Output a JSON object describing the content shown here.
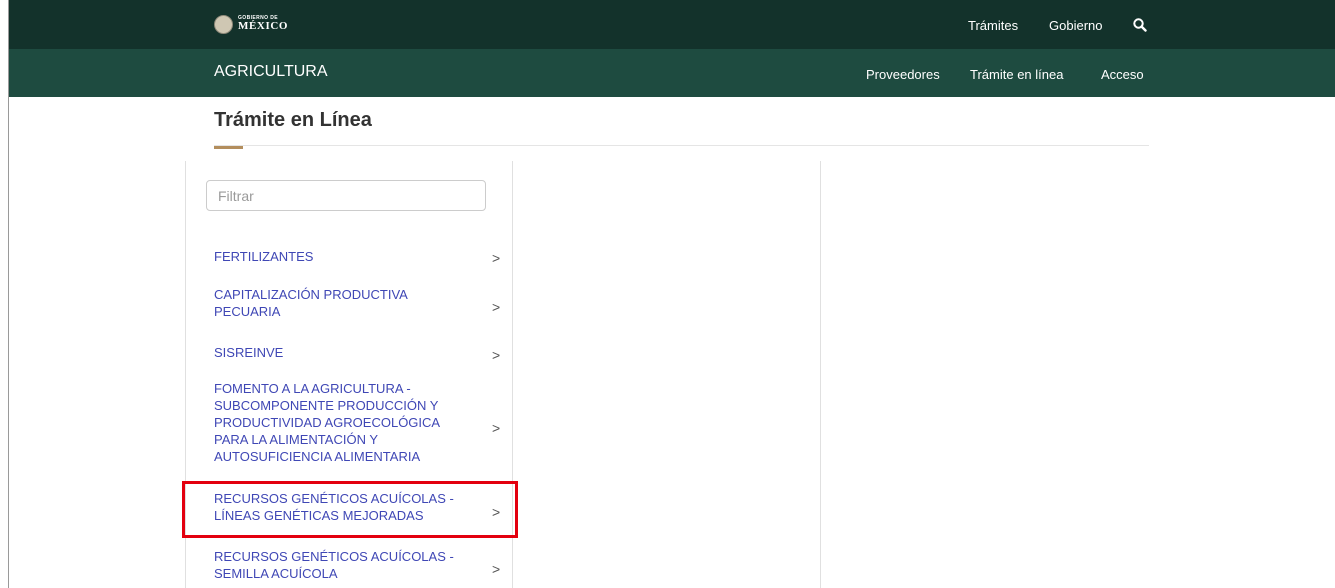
{
  "header": {
    "logo": {
      "line1": "GOBIERNO DE",
      "line2": "MÉXICO"
    },
    "nav": [
      {
        "label": "Trámites"
      },
      {
        "label": "Gobierno"
      }
    ],
    "search_icon": "search-icon",
    "colors": {
      "top_bar": "#13322b",
      "sub_bar": "#1e4b40",
      "accent": "#b38e5d"
    }
  },
  "subheader": {
    "department": "AGRICULTURA",
    "nav": [
      {
        "label": "Proveedores"
      },
      {
        "label": "Trámite en línea"
      },
      {
        "label": "Acceso"
      }
    ]
  },
  "page": {
    "title": "Trámite en Línea"
  },
  "filter": {
    "placeholder": "Filtrar",
    "value": ""
  },
  "menu": {
    "items": [
      {
        "label": "FERTILIZANTES",
        "chevron": ">"
      },
      {
        "label": "CAPITALIZACIÓN PRODUCTIVA PECUARIA",
        "chevron": ">"
      },
      {
        "label": "SISREINVE",
        "chevron": ">"
      },
      {
        "label": "FOMENTO A LA AGRICULTURA - SUBCOMPONENTE PRODUCCIÓN Y PRODUCTIVIDAD AGROECOLÓGICA PARA LA ALIMENTACIÓN Y AUTOSUFICIENCIA ALIMENTARIA",
        "chevron": ">"
      },
      {
        "label": "RECURSOS GENÉTICOS ACUÍCOLAS - LÍNEAS GENÉTICAS MEJORADAS",
        "chevron": ">",
        "highlighted": true
      },
      {
        "label": "RECURSOS GENÉTICOS ACUÍCOLAS - SEMILLA ACUÍCOLA",
        "chevron": ">"
      }
    ],
    "link_color": "#3f47b5",
    "highlight_color": "#e3000f"
  }
}
